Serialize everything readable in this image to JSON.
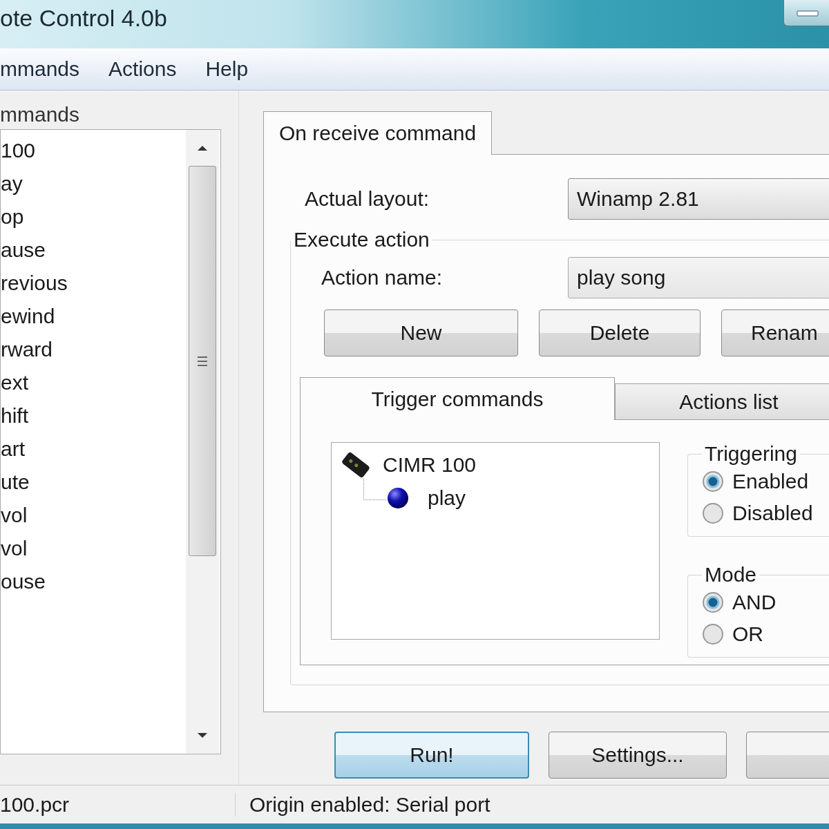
{
  "window": {
    "title": "ote Control 4.0b"
  },
  "menu": [
    "mmands",
    "Actions",
    "Help"
  ],
  "commands_panel": {
    "label": "mmands",
    "items": [
      "100",
      "ay",
      "op",
      "ause",
      "revious",
      "ewind",
      "rward",
      "ext",
      "hift",
      "art",
      "ute",
      "vol",
      "vol",
      "ouse"
    ]
  },
  "tabs": [
    {
      "label": "On receive command",
      "selected": true
    }
  ],
  "actual_layout": {
    "label": "Actual layout:",
    "value": "Winamp 2.81"
  },
  "execute_action": {
    "label": "Execute action",
    "action_name": {
      "label": "Action name:",
      "value": "play song"
    },
    "buttons": [
      "New",
      "Delete",
      "Renam"
    ],
    "tabs": [
      {
        "label": "Trigger commands",
        "selected": true
      },
      {
        "label": "Actions list",
        "selected": false
      }
    ],
    "tree": [
      {
        "label": "CIMR 100",
        "kind": "device",
        "children": [
          {
            "label": "play",
            "kind": "command"
          }
        ]
      }
    ],
    "triggering": {
      "label": "Triggering",
      "options": [
        {
          "label": "Enabled",
          "selected": true
        },
        {
          "label": "Disabled",
          "selected": false
        }
      ]
    },
    "mode": {
      "label": "Mode",
      "options": [
        {
          "label": "AND",
          "selected": true
        },
        {
          "label": "OR",
          "selected": false
        }
      ]
    }
  },
  "buttons": [
    {
      "label": "Run!",
      "default": true
    },
    {
      "label": "Settings...",
      "default": false
    },
    {
      "default": false
    }
  ],
  "status_bar": [
    "100.pcr",
    "Origin enabled: Serial port"
  ]
}
